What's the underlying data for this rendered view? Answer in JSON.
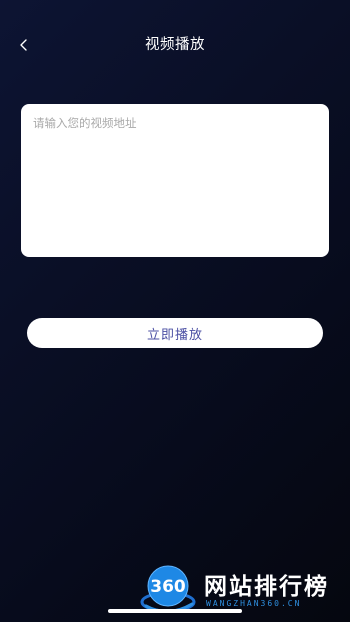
{
  "header": {
    "title": "视频播放",
    "back_icon": "chevron-left-icon"
  },
  "url_input": {
    "placeholder": "请输入您的视频地址",
    "value": ""
  },
  "play_button": {
    "label": "立即播放"
  },
  "watermark": {
    "logo_text": "360",
    "title": "网站排行榜",
    "subtitle": "WANGZHAN360.CN"
  },
  "colors": {
    "background_top": "#0d1433",
    "background_bottom": "#05070f",
    "button_text": "#4b4fa3",
    "watermark_accent": "#2f8fe0"
  }
}
